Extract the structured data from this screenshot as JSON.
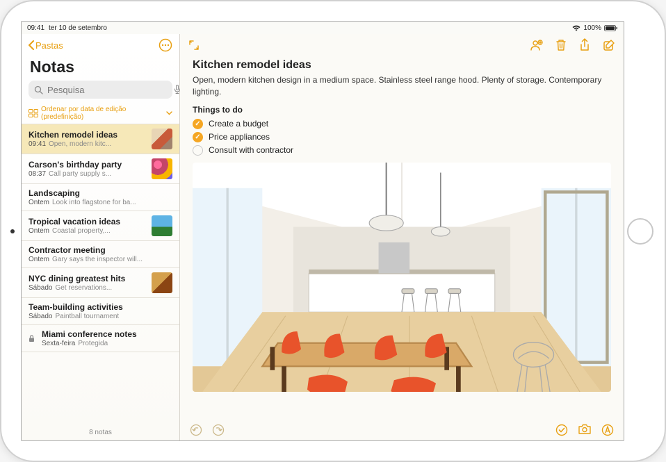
{
  "status": {
    "time": "09:41",
    "date": "ter 10 de setembro",
    "battery": "100%"
  },
  "sidebar": {
    "back": "Pastas",
    "title": "Notas",
    "search_placeholder": "Pesquisa",
    "sort_label": "Ordenar por data de edição (predefinição)",
    "footer": "8 notas",
    "items": [
      {
        "title": "Kitchen remodel ideas",
        "time": "09:41",
        "preview": "Open, modern kitc...",
        "thumb": "kitchen",
        "selected": true
      },
      {
        "title": "Carson's birthday party",
        "time": "08:37",
        "preview": "Call party supply s...",
        "thumb": "party"
      },
      {
        "title": "Landscaping",
        "time": "Ontem",
        "preview": "Look into flagstone for ba..."
      },
      {
        "title": "Tropical vacation ideas",
        "time": "Ontem",
        "preview": "Coastal property,...",
        "thumb": "beach"
      },
      {
        "title": "Contractor meeting",
        "time": "Ontem",
        "preview": "Gary says the inspector will..."
      },
      {
        "title": "NYC dining greatest hits",
        "time": "Sábado",
        "preview": "Get reservations...",
        "thumb": "food"
      },
      {
        "title": "Team-building activities",
        "time": "Sábado",
        "preview": "Paintball tournament"
      },
      {
        "title": "Miami conference notes",
        "time": "Sexta-feira",
        "preview": "Protegida",
        "locked": true
      }
    ]
  },
  "note": {
    "title": "Kitchen remodel ideas",
    "body": "Open, modern kitchen design in a medium space. Stainless steel range hood. Plenty of storage. Contemporary lighting.",
    "heading": "Things to do",
    "todos": [
      {
        "text": "Create a budget",
        "done": true
      },
      {
        "text": "Price appliances",
        "done": true
      },
      {
        "text": "Consult with contractor",
        "done": false
      }
    ]
  },
  "thumb_colors": {
    "kitchen": "linear-gradient(135deg,#e8d5b5 40%,#c85a3a 40%,#c85a3a 70%,#a0826d 70%)",
    "party": "radial-gradient(circle at 30% 30%,#ff6b9d 20%,#c44569 20%,#c44569 50%,#f8b500 50%,#f8b500 80%,#6c5ce7 80%)",
    "beach": "linear-gradient(#5eb3e4 55%,#2e7d32 55%,#2e7d32 100%)",
    "food": "linear-gradient(135deg,#d4a04c 50%,#8b4513 50%)"
  }
}
